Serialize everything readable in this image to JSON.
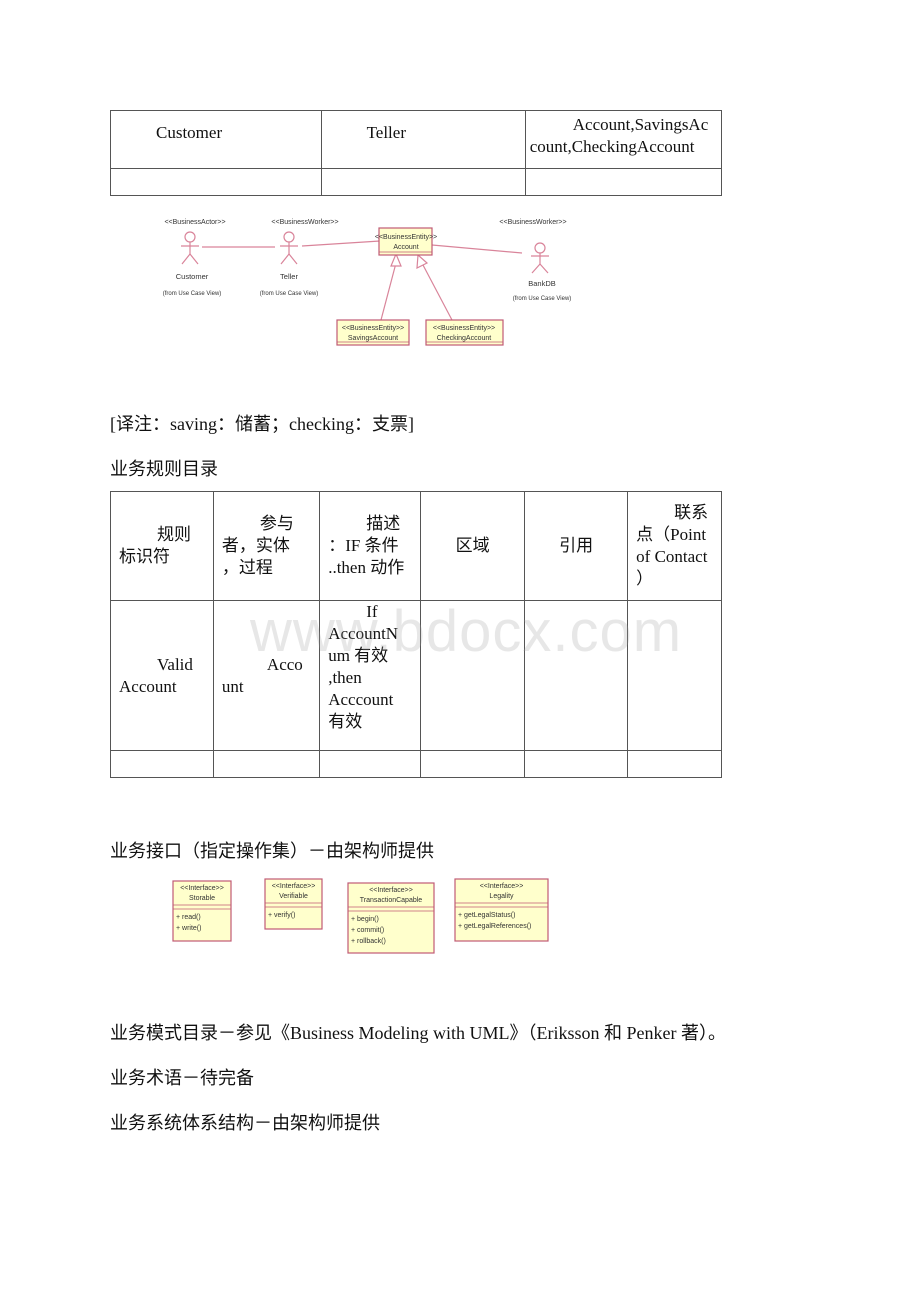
{
  "table1": {
    "rows": [
      [
        "Customer",
        "Teller",
        "Account,SavingsAccount,CheckingAccount"
      ],
      [
        "",
        "",
        ""
      ]
    ],
    "cell_lines": {
      "c0": [
        "Customer"
      ],
      "c1": [
        "Teller"
      ],
      "c2": [
        "Account,SavingsAc",
        "count,CheckingAccount"
      ]
    }
  },
  "diagram1": {
    "actors": [
      {
        "stereotype": "<<BusinessActor>>",
        "name": "Customer",
        "note": "(from Use Case View)"
      },
      {
        "stereotype": "<<BusinessWorker>>",
        "name": "Teller",
        "note": "(from Use Case View)"
      },
      {
        "stereotype": "<<BusinessWorker>>",
        "name": "BankDB",
        "note": "(from Use Case View)"
      }
    ],
    "entities": [
      {
        "stereotype": "<<BusinessEntity>>",
        "name": "Account"
      },
      {
        "stereotype": "<<BusinessEntity>>",
        "name": "SavingsAccount"
      },
      {
        "stereotype": "<<BusinessEntity>>",
        "name": "CheckingAccount"
      }
    ],
    "colors": {
      "line": "#d9849a",
      "box_fill": "#ffffcc",
      "box_border": "#c05a75"
    }
  },
  "note": "[译注：saving：储蓄；checking：支票]",
  "rules_heading": "业务规则目录",
  "rules_table": {
    "headers": [
      [
        "规则",
        "标识符"
      ],
      [
        "参与",
        "者，实体",
        "，过程"
      ],
      [
        "描述",
        "：IF 条件",
        "..then 动作"
      ],
      [
        "区域"
      ],
      [
        "引用"
      ],
      [
        "联系",
        "点（Point",
        "of Contact",
        "）"
      ]
    ],
    "rows": [
      [
        [
          "Valid",
          "Account"
        ],
        [
          "Acco",
          "unt"
        ],
        [
          "If",
          "AccountN",
          "um 有效",
          ",then",
          "Acccount",
          "有效"
        ],
        [
          ""
        ],
        [
          ""
        ],
        [
          ""
        ]
      ],
      [
        [
          ""
        ],
        [
          ""
        ],
        [
          ""
        ],
        [
          ""
        ],
        [
          ""
        ],
        [
          ""
        ]
      ]
    ]
  },
  "watermark": "www.bdocx.com",
  "interfaces_heading": "业务接口（指定操作集）－由架构师提供",
  "interfaces": [
    {
      "stereotype": "<<Interface>>",
      "name": "Storable",
      "ops": [
        "+ read()",
        "+ write()"
      ]
    },
    {
      "stereotype": "<<Interface>>",
      "name": "Verifiable",
      "ops": [
        "+ verify()"
      ]
    },
    {
      "stereotype": "<<Interface>>",
      "name": "TransactionCapable",
      "ops": [
        "+ begin()",
        "+ commit()",
        "+ rollback()"
      ]
    },
    {
      "stereotype": "<<Interface>>",
      "name": "Legality",
      "ops": [
        "+ getLegalStatus()",
        "+ getLegalReferences()"
      ]
    }
  ],
  "paragraphs": {
    "patterns": "业务模式目录－参见《Business Modeling with UML》（Eriksson 和 Penker 著）。",
    "glossary": "业务术语－待完备",
    "architecture": "业务系统体系结构－由架构师提供"
  }
}
